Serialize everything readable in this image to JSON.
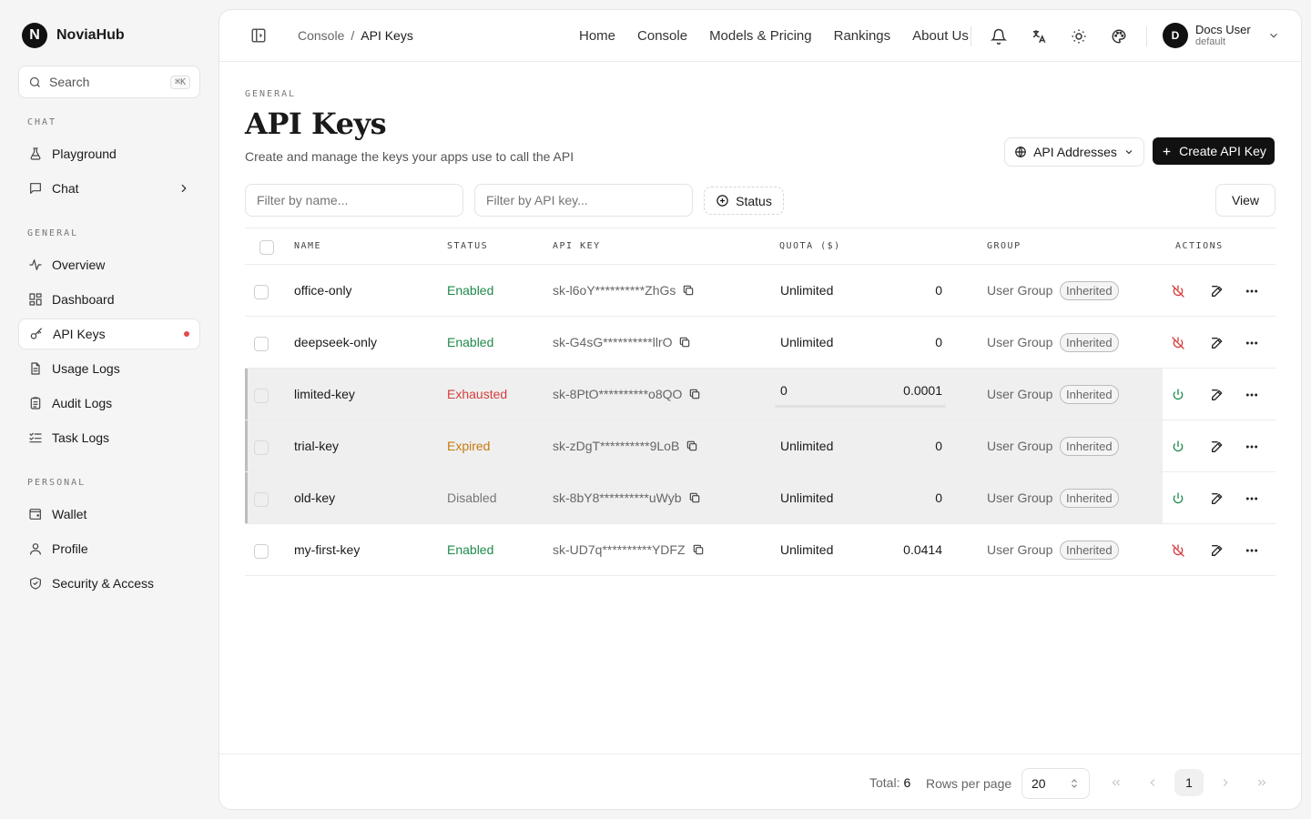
{
  "brand": {
    "logo_letter": "N",
    "name": "NoviaHub"
  },
  "search": {
    "label": "Search",
    "shortcut": "⌘K"
  },
  "sidebar": {
    "sections": [
      {
        "label": "CHAT",
        "items": [
          {
            "label": "Playground",
            "icon": "flask-icon"
          },
          {
            "label": "Chat",
            "icon": "message-icon",
            "has_chevron": true
          }
        ]
      },
      {
        "label": "GENERAL",
        "items": [
          {
            "label": "Overview",
            "icon": "activity-icon"
          },
          {
            "label": "Dashboard",
            "icon": "dashboard-icon"
          },
          {
            "label": "API Keys",
            "icon": "key-icon",
            "active": true,
            "dot": true
          },
          {
            "label": "Usage Logs",
            "icon": "file-icon"
          },
          {
            "label": "Audit Logs",
            "icon": "clipboard-icon"
          },
          {
            "label": "Task Logs",
            "icon": "list-check-icon"
          }
        ]
      },
      {
        "label": "PERSONAL",
        "items": [
          {
            "label": "Wallet",
            "icon": "wallet-icon"
          },
          {
            "label": "Profile",
            "icon": "user-icon"
          },
          {
            "label": "Security & Access",
            "icon": "shield-icon"
          }
        ]
      }
    ]
  },
  "topbar": {
    "breadcrumb": {
      "parent": "Console",
      "separator": "/",
      "current": "API Keys"
    },
    "nav": [
      "Home",
      "Console",
      "Models & Pricing",
      "Rankings",
      "About Us"
    ],
    "user": {
      "initial": "D",
      "name": "Docs User",
      "sub": "default"
    }
  },
  "page": {
    "section": "GENERAL",
    "title": "API Keys",
    "subtitle": "Create and manage the keys your apps use to call the API",
    "api_addresses_label": "API Addresses",
    "create_label": "Create API Key",
    "filter_name_placeholder": "Filter by name...",
    "filter_key_placeholder": "Filter by API key...",
    "status_filter_label": "Status",
    "view_label": "View"
  },
  "table": {
    "headers": {
      "name": "NAME",
      "status": "STATUS",
      "api_key": "API KEY",
      "quota": "QUOTA ($)",
      "group": "GROUP",
      "actions": "ACTIONS"
    },
    "rows": [
      {
        "name": "office-only",
        "status": "Enabled",
        "status_kind": "enabled",
        "key": "sk-l6oY**********ZhGs",
        "quota": "Unlimited",
        "used": "0",
        "group": "User Group",
        "badge": "Inherited",
        "dim": false,
        "toggle": "disable"
      },
      {
        "name": "deepseek-only",
        "status": "Enabled",
        "status_kind": "enabled",
        "key": "sk-G4sG**********llrO",
        "quota": "Unlimited",
        "used": "0",
        "group": "User Group",
        "badge": "Inherited",
        "dim": false,
        "toggle": "disable"
      },
      {
        "name": "limited-key",
        "status": "Exhausted",
        "status_kind": "exhausted",
        "key": "sk-8PtO**********o8QO",
        "quota": "0",
        "used": "0.0001",
        "group": "User Group",
        "badge": "Inherited",
        "dim": true,
        "toggle": "enable",
        "quota_bar": true
      },
      {
        "name": "trial-key",
        "status": "Expired",
        "status_kind": "expired",
        "key": "sk-zDgT**********9LoB",
        "quota": "Unlimited",
        "used": "0",
        "group": "User Group",
        "badge": "Inherited",
        "dim": true,
        "toggle": "enable"
      },
      {
        "name": "old-key",
        "status": "Disabled",
        "status_kind": "disabled",
        "key": "sk-8bY8**********uWyb",
        "quota": "Unlimited",
        "used": "0",
        "group": "User Group",
        "badge": "Inherited",
        "dim": true,
        "toggle": "enable"
      },
      {
        "name": "my-first-key",
        "status": "Enabled",
        "status_kind": "enabled",
        "key": "sk-UD7q**********YDFZ",
        "quota": "Unlimited",
        "used": "0.0414",
        "group": "User Group",
        "badge": "Inherited",
        "dim": false,
        "toggle": "disable"
      }
    ]
  },
  "footer": {
    "total_label": "Total:",
    "total_value": "6",
    "rows_per_page_label": "Rows per page",
    "rows_per_page_value": "20",
    "current_page": "1"
  }
}
